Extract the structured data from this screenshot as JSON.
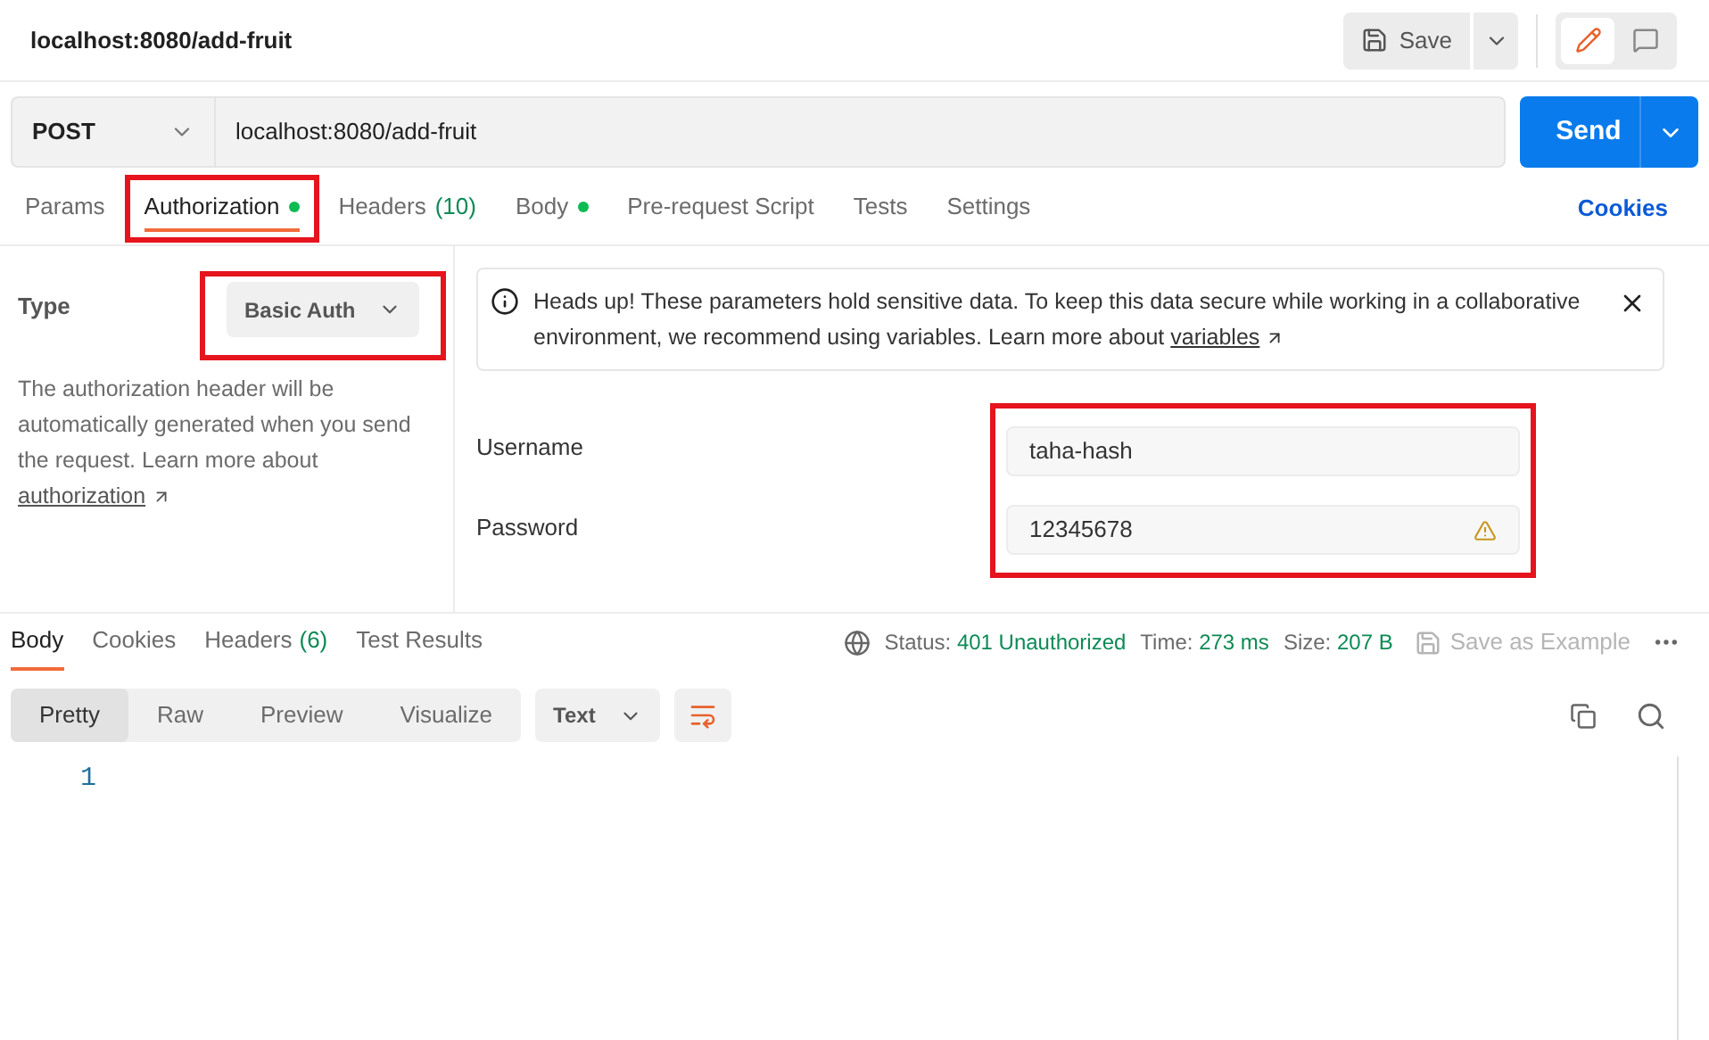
{
  "title": "localhost:8080/add-fruit",
  "save_button": "Save",
  "mode_toggle": [
    {
      "kind": "edit",
      "selected": true
    },
    {
      "kind": "comment",
      "selected": false
    }
  ],
  "request": {
    "method": "POST",
    "url": "localhost:8080/add-fruit",
    "send": "Send"
  },
  "request_tabs": [
    {
      "label": "Params",
      "selected": false,
      "dot": false,
      "highlighted": false
    },
    {
      "label": "Authorization",
      "selected": true,
      "dot": true,
      "highlighted": true
    },
    {
      "label": "Headers",
      "count": "(10)",
      "selected": false,
      "dot": false,
      "highlighted": false
    },
    {
      "label": "Body",
      "selected": false,
      "dot": true,
      "highlighted": false
    },
    {
      "label": "Pre-request Script",
      "selected": false,
      "dot": false,
      "highlighted": false
    },
    {
      "label": "Tests",
      "selected": false,
      "dot": false,
      "highlighted": false
    },
    {
      "label": "Settings",
      "selected": false,
      "dot": false,
      "highlighted": false
    }
  ],
  "cookies_link": "Cookies",
  "auth": {
    "type_label": "Type",
    "type_value": "Basic Auth",
    "type_highlighted": true,
    "description": "The authorization header will be automatically generated when you send the request. Learn more about",
    "link": "authorization"
  },
  "notice": {
    "text": "Heads up! These parameters hold sensitive data. To keep this data secure while working in a collaborative environment, we recommend using variables. Learn more about",
    "link": "variables"
  },
  "credentials": {
    "highlighted": true,
    "fields": [
      {
        "label": "Username",
        "value": "taha-hash",
        "warning": false
      },
      {
        "label": "Password",
        "value": "12345678",
        "warning": true
      }
    ]
  },
  "response": {
    "tabs": [
      {
        "label": "Body",
        "selected": true
      },
      {
        "label": "Cookies",
        "selected": false
      },
      {
        "label": "Headers",
        "count": "(6)",
        "selected": false
      },
      {
        "label": "Test Results",
        "selected": false
      }
    ],
    "status": [
      {
        "label": "Status:",
        "value": "401 Unauthorized"
      },
      {
        "label": "Time:",
        "value": "273 ms"
      },
      {
        "label": "Size:",
        "value": "207 B"
      }
    ],
    "save_example": {
      "label": "Save as Example",
      "disabled": true
    },
    "views": [
      {
        "label": "Pretty",
        "selected": true
      },
      {
        "label": "Raw",
        "selected": false
      },
      {
        "label": "Preview",
        "selected": false
      },
      {
        "label": "Visualize",
        "selected": false
      }
    ],
    "format": "Text",
    "wrap_on": true,
    "lines": [
      "1"
    ]
  }
}
